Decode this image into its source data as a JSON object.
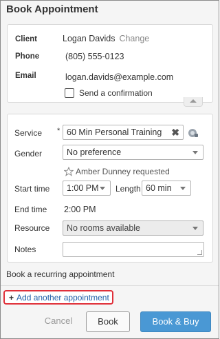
{
  "dialog": {
    "title": "Book Appointment"
  },
  "client": {
    "client_label": "Client",
    "client_name": "Logan Davids",
    "change_label": "Change",
    "phone_label": "Phone",
    "phone_value": "(805) 555-0123",
    "email_label": "Email",
    "email_value": "logan.davids@example.com",
    "confirmation_label": "Send a confirmation",
    "confirmation_checked": false
  },
  "service": {
    "service_label": "Service",
    "required_mark": "*",
    "service_value": "60 Min Personal Training",
    "gender_label": "Gender",
    "gender_value": "No preference",
    "requested_text": "Amber Dunney requested",
    "start_label": "Start time",
    "start_value": "1:00 PM",
    "length_label": "Length",
    "length_value": "60 min",
    "end_label": "End time",
    "end_value": "2:00 PM",
    "resource_label": "Resource",
    "resource_value": "No rooms available",
    "notes_label": "Notes",
    "notes_value": ""
  },
  "recurring_link": "Book a recurring appointment",
  "add_another": {
    "plus": "+",
    "label": "Add another appointment"
  },
  "footer": {
    "cancel_label": "Cancel",
    "book_label": "Book",
    "book_buy_label": "Book & Buy"
  },
  "colors": {
    "primary_button": "#4a98d4",
    "highlight_border": "#e0303a",
    "link": "#1f5fa8"
  }
}
